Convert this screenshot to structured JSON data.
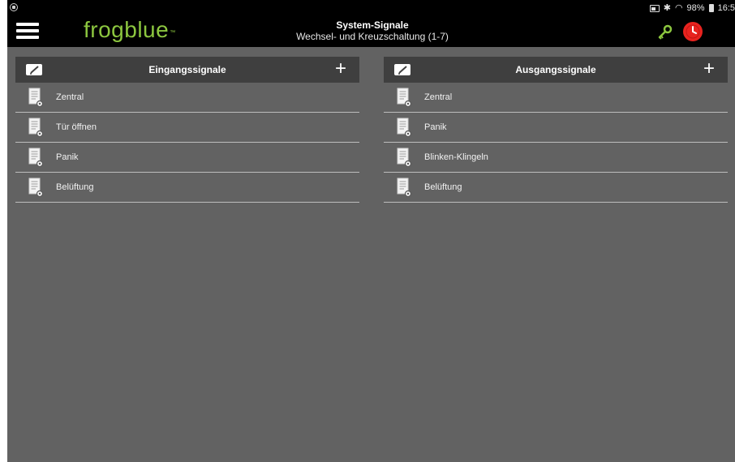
{
  "statusbar": {
    "battery": "98%",
    "time": "16:5"
  },
  "app": {
    "logo": "frogblue",
    "logo_tm": "™",
    "title": "System-Signale",
    "subtitle": "Wechsel- und Kreuzschaltung (1-7)"
  },
  "colors": {
    "brand_green": "#8cc63f",
    "clock_red": "#e8231f",
    "background": "#626262",
    "header_bg": "#3f3f3f"
  },
  "icons": {
    "menu": "hamburger-menu-icon",
    "key": "key-icon",
    "clock": "clock-icon",
    "edit": "edit-icon",
    "add": "plus-icon",
    "item": "document-icon"
  },
  "input_panel": {
    "title": "Eingangssignale",
    "items": [
      {
        "label": "Zentral"
      },
      {
        "label": "Tür öffnen"
      },
      {
        "label": "Panik"
      },
      {
        "label": "Belüftung"
      }
    ]
  },
  "output_panel": {
    "title": "Ausgangssignale",
    "items": [
      {
        "label": "Zentral"
      },
      {
        "label": "Panik"
      },
      {
        "label": "Blinken-Klingeln"
      },
      {
        "label": "Belüftung"
      }
    ]
  }
}
